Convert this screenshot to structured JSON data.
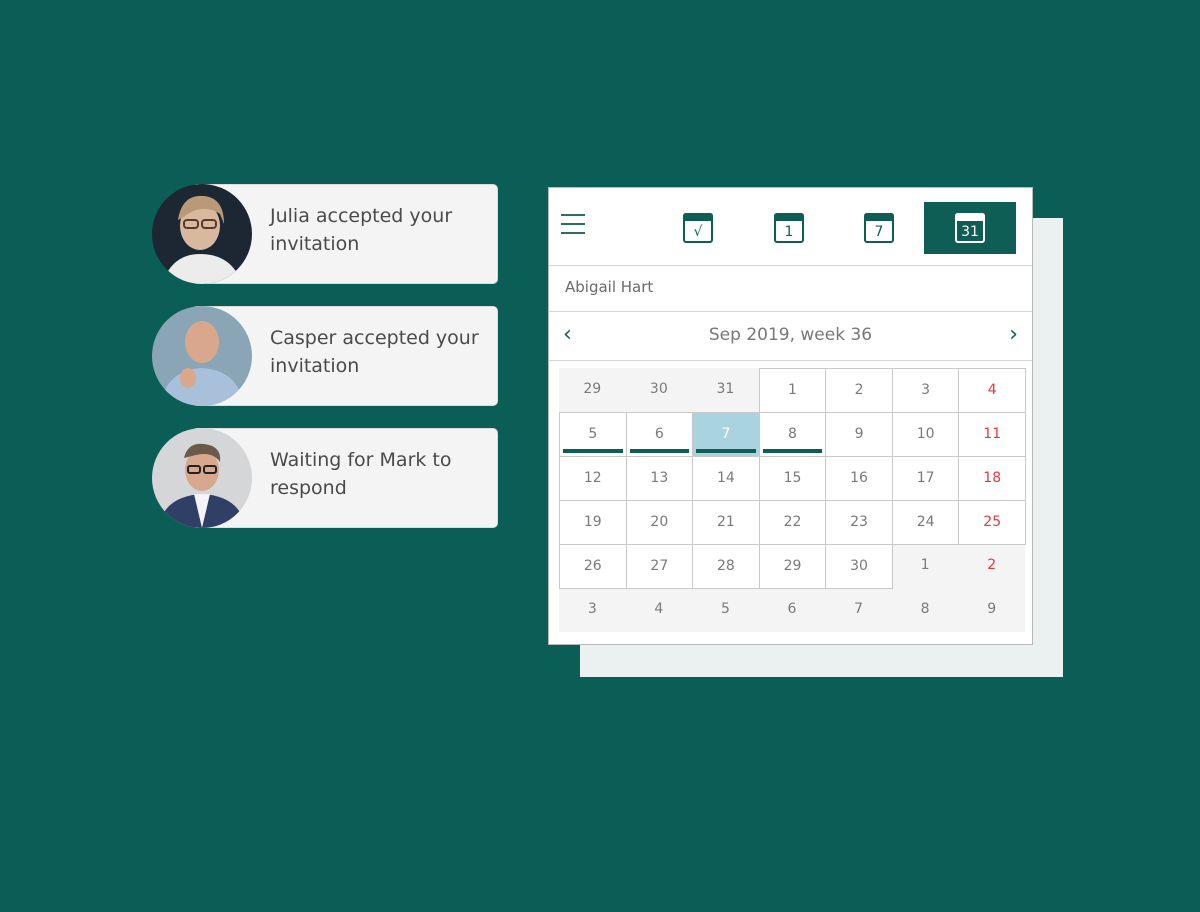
{
  "notifications": [
    {
      "text": "Julia accepted your invitation",
      "person": "Julia",
      "status": "accepted"
    },
    {
      "text": "Casper accepted your invitation",
      "person": "Casper",
      "status": "accepted"
    },
    {
      "text": "Waiting for Mark to respond",
      "person": "Mark",
      "status": "waiting"
    }
  ],
  "calendar": {
    "toolbar": {
      "menu_icon": "hamburger-menu-icon",
      "views": [
        {
          "name": "tasks",
          "icon": "calendar-check-icon",
          "glyph": "√",
          "active": false
        },
        {
          "name": "day",
          "icon": "calendar-day-icon",
          "glyph": "1",
          "active": false
        },
        {
          "name": "week",
          "icon": "calendar-week-icon",
          "glyph": "7",
          "active": false
        },
        {
          "name": "month",
          "icon": "calendar-month-icon",
          "glyph": "31",
          "active": true
        }
      ]
    },
    "owner": "Abigail Hart",
    "nav": {
      "title": "Sep 2019, week 36",
      "prev_icon": "chevron-left-icon",
      "next_icon": "chevron-right-icon",
      "prev": "‹",
      "next": "›"
    },
    "colors": {
      "accent": "#0e5e56",
      "selected": "#a9d3de",
      "weekend": "#e8383d",
      "background": "#0a5e56"
    },
    "weeks": [
      [
        {
          "d": "29",
          "cur": false
        },
        {
          "d": "30",
          "cur": false
        },
        {
          "d": "31",
          "cur": false
        },
        {
          "d": "1",
          "cur": true
        },
        {
          "d": "2",
          "cur": true
        },
        {
          "d": "3",
          "cur": true
        },
        {
          "d": "4",
          "cur": true,
          "weekend": true
        }
      ],
      [
        {
          "d": "5",
          "cur": true,
          "event": true
        },
        {
          "d": "6",
          "cur": true,
          "event": true
        },
        {
          "d": "7",
          "cur": true,
          "event": true,
          "selected": true
        },
        {
          "d": "8",
          "cur": true,
          "event": true
        },
        {
          "d": "9",
          "cur": true
        },
        {
          "d": "10",
          "cur": true
        },
        {
          "d": "11",
          "cur": true,
          "weekend": true
        }
      ],
      [
        {
          "d": "12",
          "cur": true
        },
        {
          "d": "13",
          "cur": true
        },
        {
          "d": "14",
          "cur": true
        },
        {
          "d": "15",
          "cur": true
        },
        {
          "d": "16",
          "cur": true
        },
        {
          "d": "17",
          "cur": true
        },
        {
          "d": "18",
          "cur": true,
          "weekend": true
        }
      ],
      [
        {
          "d": "19",
          "cur": true
        },
        {
          "d": "20",
          "cur": true
        },
        {
          "d": "21",
          "cur": true
        },
        {
          "d": "22",
          "cur": true
        },
        {
          "d": "23",
          "cur": true
        },
        {
          "d": "24",
          "cur": true
        },
        {
          "d": "25",
          "cur": true,
          "weekend": true
        }
      ],
      [
        {
          "d": "26",
          "cur": true
        },
        {
          "d": "27",
          "cur": true
        },
        {
          "d": "28",
          "cur": true
        },
        {
          "d": "29",
          "cur": true
        },
        {
          "d": "30",
          "cur": true
        },
        {
          "d": "1",
          "cur": false
        },
        {
          "d": "2",
          "cur": false,
          "weekend": true
        }
      ],
      [
        {
          "d": "3",
          "cur": false
        },
        {
          "d": "4",
          "cur": false
        },
        {
          "d": "5",
          "cur": false
        },
        {
          "d": "6",
          "cur": false
        },
        {
          "d": "7",
          "cur": false
        },
        {
          "d": "8",
          "cur": false
        },
        {
          "d": "9",
          "cur": false
        }
      ]
    ]
  }
}
